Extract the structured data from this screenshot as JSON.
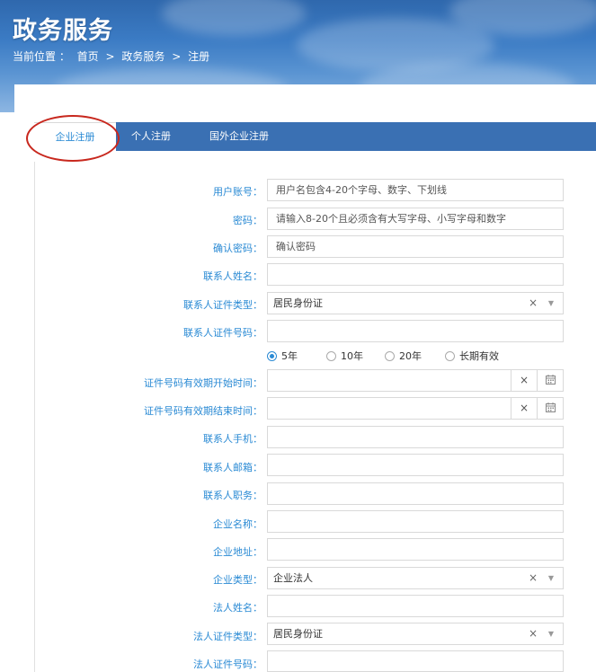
{
  "header": {
    "title": "政务服务",
    "breadcrumb": {
      "label": "当前位置 ：",
      "items": [
        "首页",
        ">",
        "政务服务",
        ">",
        "注册"
      ]
    }
  },
  "tabs": [
    {
      "label": "企业注册",
      "active": true
    },
    {
      "label": "个人注册",
      "active": false
    },
    {
      "label": "国外企业注册",
      "active": false
    }
  ],
  "form": {
    "username": {
      "label": "用户账号：",
      "placeholder": "用户名包含4-20个字母、数字、下划线"
    },
    "password": {
      "label": "密码：",
      "placeholder": "请输入8-20个且必须含有大写字母、小写字母和数字"
    },
    "confirm_password": {
      "label": "确认密码：",
      "placeholder": "确认密码"
    },
    "contact_name": {
      "label": "联系人姓名：",
      "value": ""
    },
    "contact_id_type": {
      "label": "联系人证件类型：",
      "value": "居民身份证",
      "clear": "×",
      "caret": "▼"
    },
    "contact_id_number": {
      "label": "联系人证件号码：",
      "value": ""
    },
    "validity_options": [
      {
        "label": "5年",
        "selected": true
      },
      {
        "label": "10年",
        "selected": false
      },
      {
        "label": "20年",
        "selected": false
      },
      {
        "label": "长期有效",
        "selected": false
      }
    ],
    "id_start_date": {
      "label": "证件号码有效期开始时间：",
      "value": "",
      "clear": "×"
    },
    "id_end_date": {
      "label": "证件号码有效期结束时间：",
      "value": "",
      "clear": "×"
    },
    "contact_mobile": {
      "label": "联系人手机：",
      "value": ""
    },
    "contact_email": {
      "label": "联系人邮箱：",
      "value": ""
    },
    "contact_position": {
      "label": "联系人职务：",
      "value": ""
    },
    "company_name": {
      "label": "企业名称：",
      "value": ""
    },
    "company_address": {
      "label": "企业地址：",
      "value": ""
    },
    "company_type": {
      "label": "企业类型：",
      "value": "企业法人",
      "clear": "×",
      "caret": "▼"
    },
    "legal_name": {
      "label": "法人姓名：",
      "value": ""
    },
    "legal_id_type": {
      "label": "法人证件类型：",
      "value": "居民身份证",
      "clear": "×",
      "caret": "▼"
    },
    "legal_id_number": {
      "label": "法人证件号码：",
      "value": ""
    }
  },
  "colors": {
    "accent": "#2a8ad4",
    "tabbar": "#3a70b3",
    "marker": "#c8281e"
  }
}
